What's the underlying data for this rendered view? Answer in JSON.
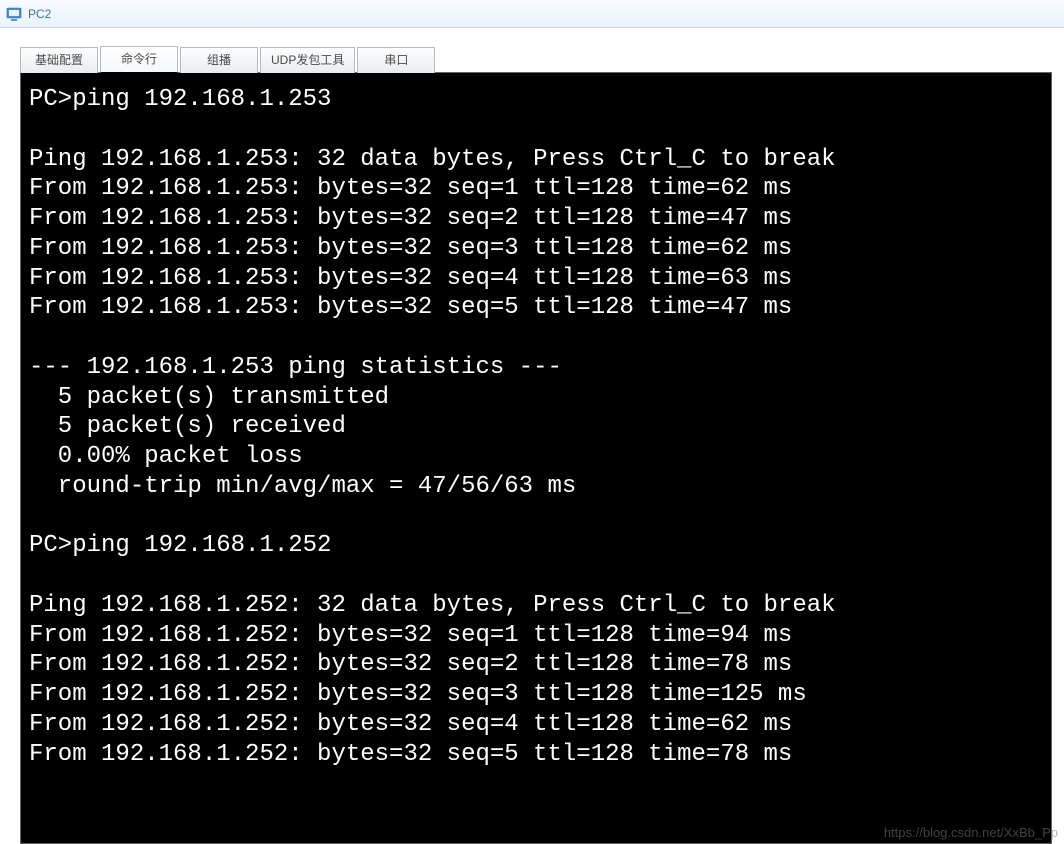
{
  "window": {
    "title": "PC2"
  },
  "tabs": [
    {
      "label": "基础配置"
    },
    {
      "label": "命令行"
    },
    {
      "label": "组播"
    },
    {
      "label": "UDP发包工具"
    },
    {
      "label": "串口"
    }
  ],
  "terminal": {
    "lines": [
      "PC>ping 192.168.1.253",
      "",
      "Ping 192.168.1.253: 32 data bytes, Press Ctrl_C to break",
      "From 192.168.1.253: bytes=32 seq=1 ttl=128 time=62 ms",
      "From 192.168.1.253: bytes=32 seq=2 ttl=128 time=47 ms",
      "From 192.168.1.253: bytes=32 seq=3 ttl=128 time=62 ms",
      "From 192.168.1.253: bytes=32 seq=4 ttl=128 time=63 ms",
      "From 192.168.1.253: bytes=32 seq=5 ttl=128 time=47 ms",
      "",
      "--- 192.168.1.253 ping statistics ---",
      "  5 packet(s) transmitted",
      "  5 packet(s) received",
      "  0.00% packet loss",
      "  round-trip min/avg/max = 47/56/63 ms",
      "",
      "PC>ping 192.168.1.252",
      "",
      "Ping 192.168.1.252: 32 data bytes, Press Ctrl_C to break",
      "From 192.168.1.252: bytes=32 seq=1 ttl=128 time=94 ms",
      "From 192.168.1.252: bytes=32 seq=2 ttl=128 time=78 ms",
      "From 192.168.1.252: bytes=32 seq=3 ttl=128 time=125 ms",
      "From 192.168.1.252: bytes=32 seq=4 ttl=128 time=62 ms",
      "From 192.168.1.252: bytes=32 seq=5 ttl=128 time=78 ms"
    ]
  },
  "watermark": "https://blog.csdn.net/XxBb_Pp"
}
